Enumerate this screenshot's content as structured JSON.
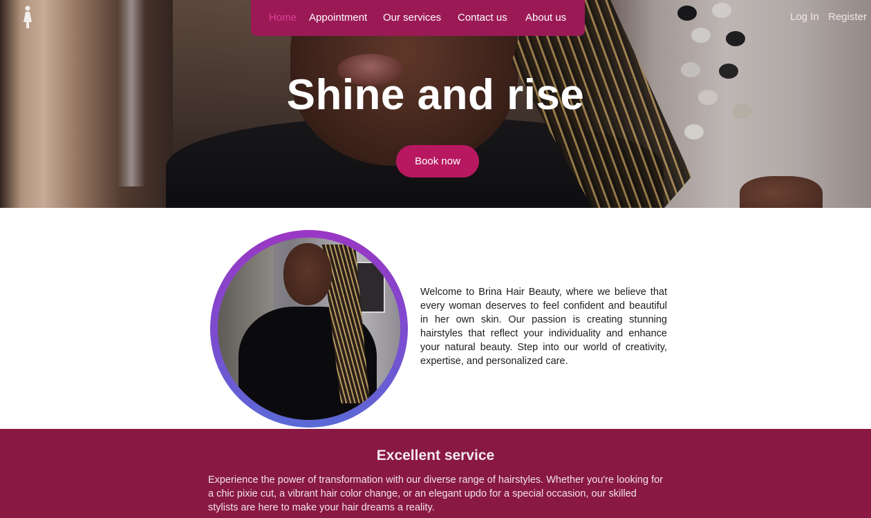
{
  "nav": {
    "items": [
      {
        "label": "Home",
        "active": true
      },
      {
        "label": "Appointment",
        "active": false
      },
      {
        "label": "Our services",
        "active": false
      },
      {
        "label": "Contact us",
        "active": false
      },
      {
        "label": "About us",
        "active": false
      }
    ],
    "login_label": "Log In",
    "register_label": "Register",
    "logo_icon": "woman-figure-icon"
  },
  "hero": {
    "title": "Shine and rise",
    "cta_label": "Book now"
  },
  "welcome": {
    "text": "Welcome to Brina Hair Beauty, where we believe that every woman deserves to feel confident and beautiful in her own skin. Our passion is creating stunning hairstyles that reflect your individuality and enhance your natural beauty. Step into our world of creativity, expertise, and personalized care."
  },
  "service": {
    "title": "Excellent service",
    "text": "Experience the power of transformation with our diverse range of hairstyles. Whether you're looking for a chic pixie cut, a vibrant hair color change, or an elegant updo for a special occasion, our skilled stylists are here to make your hair dreams a reality."
  },
  "colors": {
    "nav_bg": "#9b1a56",
    "nav_active": "#e0409a",
    "button": "#b7185f",
    "service_bg": "#891843",
    "ring_top": "#9a37c3",
    "ring_bottom": "#5a6ad6"
  }
}
